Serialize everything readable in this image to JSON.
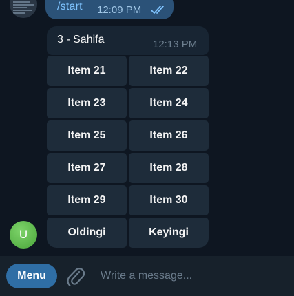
{
  "outgoing": {
    "text": "/start",
    "time": "12:09 PM",
    "status_icon": "double-check-icon"
  },
  "incoming": {
    "text": "3 - Sahifa",
    "time": "12:13 PM"
  },
  "keyboard": {
    "rows": [
      [
        "Item 21",
        "Item 22"
      ],
      [
        "Item 23",
        "Item 24"
      ],
      [
        "Item 25",
        "Item 26"
      ],
      [
        "Item 27",
        "Item 28"
      ],
      [
        "Item 29",
        "Item 30"
      ],
      [
        "Oldingi",
        "Keyingi"
      ]
    ]
  },
  "user_avatar": {
    "initial": "U",
    "color": "#5ebd4c"
  },
  "composer": {
    "menu_label": "Menu",
    "attach_icon": "paperclip-icon",
    "placeholder": "Write a message..."
  },
  "colors": {
    "background": "#0e1621",
    "outgoing_bubble": "#2b5278",
    "incoming_bubble": "#182533",
    "keyboard_button": "#1e2c3a",
    "composer": "#17212b",
    "accent": "#2f6ea5"
  }
}
